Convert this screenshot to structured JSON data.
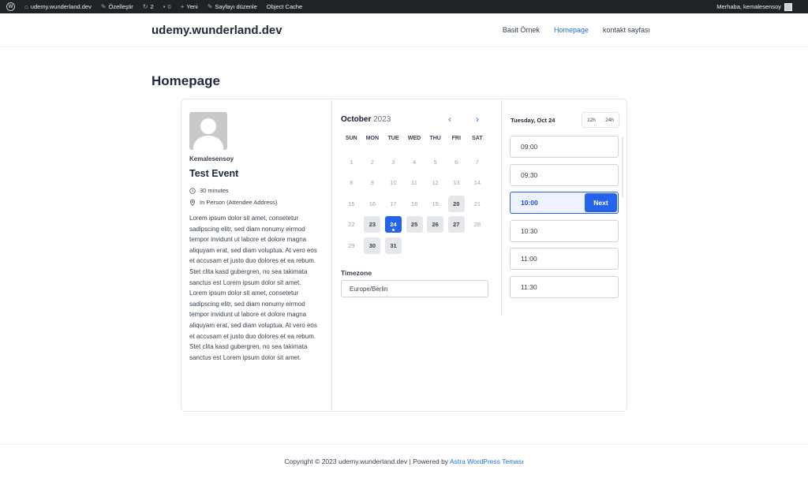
{
  "adminbar": {
    "site": "udemy.wunderland.dev",
    "customize": "Özelleştir",
    "updates": "2",
    "comments": "0",
    "new": "Yeni",
    "edit_page": "Sayfayı düzenle",
    "object_cache": "Object Cache",
    "greeting": "Merhaba, kemalesensoy"
  },
  "header": {
    "site_title": "udemy.wunderland.dev",
    "nav": [
      "Basit Örnek",
      "Homepage",
      "kontakt sayfası"
    ]
  },
  "page": {
    "title": "Homepage"
  },
  "event": {
    "host": "Kemalesensoy",
    "title": "Test Event",
    "duration": "30 minutes",
    "location": "In Person (Attendee Address)",
    "description": "Lorem ipsum dolor sit amet, consetetur sadipscing elitr, sed diam nonumy eirmod tempor invidunt ut labore et dolore magna aliquyam erat, sed diam voluptua. At vero eos et accusam et justo duo dolores et ea rebum. Stet clita kasd gubergren, no sea takimata sanctus est Lorem ipsum dolor sit amet. Lorem ipsum dolor sit amet, consetetur sadipscing elitr, sed diam nonumy eirmod tempor invidunt ut labore et dolore magna aliquyam erat, sed diam voluptua. At vero eos et accusam et justo duo dolores et ea rebum. Stet clita kasd gubergren, no sea takimata sanctus est Lorem ipsum dolor sit amet."
  },
  "calendar": {
    "month": "October",
    "year": "2023",
    "weekdays": [
      "SUN",
      "MON",
      "TUE",
      "WED",
      "THU",
      "FRI",
      "SAT"
    ],
    "start_offset": 0,
    "days_in_month": 31,
    "available_days": [
      20,
      23,
      25,
      26,
      27,
      30,
      31
    ],
    "selected_day": 24
  },
  "timezone": {
    "label": "Timezone",
    "value": "Europe/Berlin"
  },
  "slots": {
    "date_label": "Tuesday, Oct 24",
    "format_12h": "12h",
    "format_24h": "24h",
    "times": [
      "09:00",
      "09:30",
      "10:00",
      "10:30",
      "11:00",
      "11:30"
    ],
    "selected": "10:00",
    "next_label": "Next"
  },
  "footer": {
    "text": "Copyright © 2023 udemy.wunderland.dev | Powered by ",
    "link": "Astra WordPress Teması"
  },
  "colors": {
    "accent": "#2563eb",
    "link": "#1e6fd9",
    "adminbar": "#1d2327"
  }
}
